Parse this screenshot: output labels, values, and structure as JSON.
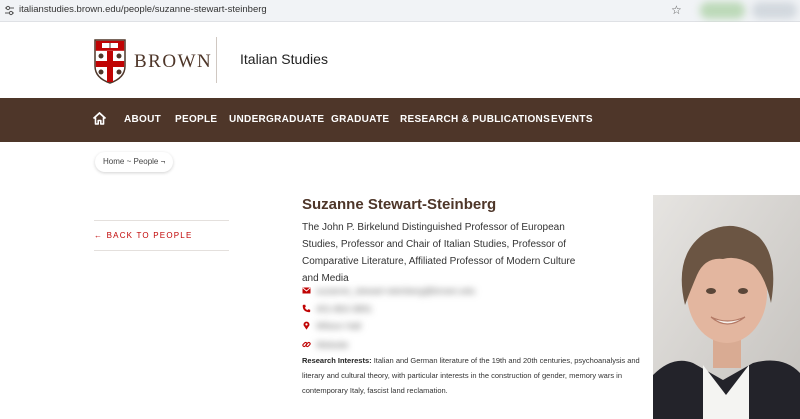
{
  "browser": {
    "url": "italianstudies.brown.edu/people/suzanne-stewart-steinberg"
  },
  "brand": {
    "wordmark": "BROWN",
    "department": "Italian Studies"
  },
  "nav": {
    "home_icon": "home-icon",
    "items": [
      "ABOUT",
      "PEOPLE",
      "UNDERGRADUATE",
      "GRADUATE",
      "RESEARCH & PUBLICATIONS",
      "EVENTS"
    ]
  },
  "breadcrumb": {
    "text": "Home ~ People ¬"
  },
  "sidebar": {
    "back_label": "← BACK TO PEOPLE"
  },
  "profile": {
    "name": "Suzanne Stewart-Steinberg",
    "title": "The John P. Birkelund Distinguished Professor of European Studies, Professor and Chair of Italian Studies, Professor of Comparative Literature, Affiliated Professor of Modern Culture and Media",
    "contacts": [
      {
        "icon": "email-icon",
        "value": "suzanne_stewart-steinberg@brown.edu"
      },
      {
        "icon": "phone-icon",
        "value": "401-863-3891"
      },
      {
        "icon": "location-icon",
        "value": "Wilson Hall"
      },
      {
        "icon": "link-icon",
        "value": "Website"
      }
    ],
    "interests_label": "Research Interests:",
    "interests_text": "Italian and German literature of the 19th and 20th centuries, psychoanalysis and literary and cultural theory, with particular interests in the construction of gender, memory wars in contemporary Italy, fascist land reclamation."
  },
  "colors": {
    "brand_brown": "#4e3629",
    "accent_red": "#c00404"
  }
}
